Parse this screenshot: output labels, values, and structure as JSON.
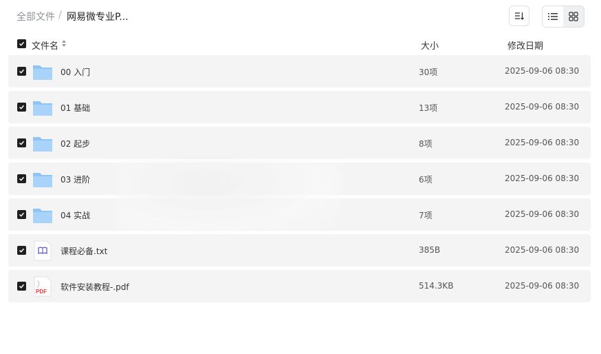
{
  "breadcrumb": {
    "root": "全部文件",
    "separator": "/",
    "current": "网易微专业P..."
  },
  "header": {
    "name": "文件名",
    "size": "大小",
    "date": "修改日期"
  },
  "files": [
    {
      "name": "00 入门",
      "size": "30项",
      "date": "2025-09-06 08:30",
      "type": "folder"
    },
    {
      "name": "01 基础",
      "size": "13项",
      "date": "2025-09-06 08:30",
      "type": "folder"
    },
    {
      "name": "02 起步",
      "size": "8项",
      "date": "2025-09-06 08:30",
      "type": "folder"
    },
    {
      "name": "03 进阶",
      "size": "6项",
      "date": "2025-09-06 08:30",
      "type": "folder"
    },
    {
      "name": "04 实战",
      "size": "7项",
      "date": "2025-09-06 08:30",
      "type": "folder"
    },
    {
      "name": "课程必备.txt",
      "size": "385B",
      "date": "2025-09-06 08:30",
      "type": "txt"
    },
    {
      "name": "软件安装教程-.pdf",
      "size": "514.3KB",
      "date": "2025-09-06 08:30",
      "type": "pdf"
    }
  ],
  "pdf_icon_label": "PDF",
  "colors": {
    "folder": "#8ec5f5",
    "checkbox": "#1f1f1f",
    "row_bg": "#f4f4f5"
  }
}
